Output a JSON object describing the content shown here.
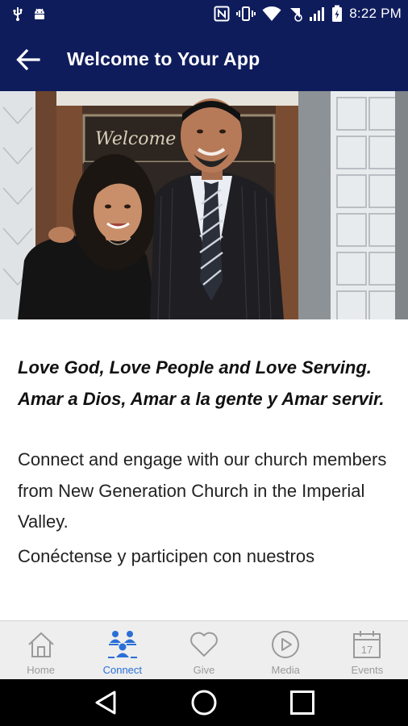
{
  "status_bar": {
    "time": "8:22 PM",
    "left_icons": [
      "usb-icon",
      "android-icon"
    ],
    "right_icons": [
      "nfc-icon",
      "vibrate-icon",
      "wifi-icon",
      "signal-icon",
      "battery-icon"
    ]
  },
  "app_bar": {
    "title": "Welcome to Your App",
    "back_icon": "arrow-left-icon"
  },
  "hero": {
    "sign_text": "Welcome"
  },
  "content": {
    "tagline": "Love God, Love People and Love Serving. Amar a Dios, Amar a la gente y Amar servir.",
    "paragraph_1": "Connect and engage with our church members from New Generation Church in the Imperial Valley.",
    "paragraph_2": "Conéctense y participen con nuestros"
  },
  "bottom_nav": {
    "items": [
      {
        "label": "Home",
        "icon": "home-icon",
        "active": false
      },
      {
        "label": "Connect",
        "icon": "people-icon",
        "active": true
      },
      {
        "label": "Give",
        "icon": "heart-icon",
        "active": false
      },
      {
        "label": "Media",
        "icon": "play-icon",
        "active": false
      },
      {
        "label": "Events",
        "icon": "calendar-icon",
        "active": false
      }
    ],
    "events_day": "17"
  },
  "colors": {
    "primary": "#0f1c5c",
    "active_tab": "#2a6fd6",
    "inactive_tab": "#9a9a9a",
    "nav_background": "#eeeeee"
  }
}
